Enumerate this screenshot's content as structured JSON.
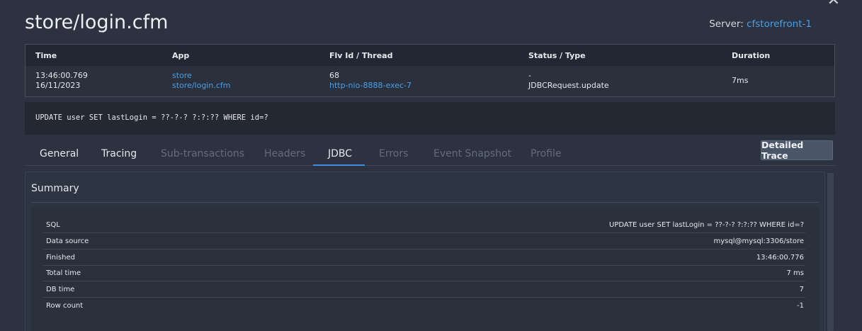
{
  "page": {
    "title": "store/login.cfm"
  },
  "server": {
    "label": "Server:",
    "name": "cfstorefront-1"
  },
  "summary": {
    "headers": {
      "time": "Time",
      "app": "App",
      "flv": "Flv Id / Thread",
      "status": "Status / Type",
      "duration": "Duration"
    },
    "row": {
      "time_line1": "13:46:00.769",
      "time_line2": "16/11/2023",
      "app_line1": "store",
      "app_line2": "store/login.cfm",
      "flv_line1": "68",
      "flv_line2": "http-nio-8888-exec-7",
      "status_line1": "-",
      "status_line2": "JDBCRequest.update",
      "duration": "7ms"
    }
  },
  "sql_statement": "UPDATE user SET lastLogin = ??-?-? ?:?:?? WHERE id=?",
  "tabs": [
    {
      "label": "General",
      "state": "enabled"
    },
    {
      "label": "Tracing",
      "state": "enabled"
    },
    {
      "label": "Sub-transactions",
      "state": "disabled"
    },
    {
      "label": "Headers",
      "state": "disabled"
    },
    {
      "label": "JDBC",
      "state": "active"
    },
    {
      "label": "Errors",
      "state": "disabled"
    },
    {
      "label": "Event Snapshot",
      "state": "disabled"
    },
    {
      "label": "Profile",
      "state": "disabled"
    }
  ],
  "detailed_trace_label": "Detailed Trace",
  "panel": {
    "title": "Summary",
    "rows": [
      {
        "key": "SQL",
        "value": "UPDATE user SET lastLogin = ??-?-? ?:?:?? WHERE id=?"
      },
      {
        "key": "Data source",
        "value": "mysql@mysql:3306/store"
      },
      {
        "key": "Finished",
        "value": "13:46:00.776"
      },
      {
        "key": "Total time",
        "value": "7 ms"
      },
      {
        "key": "DB time",
        "value": "7"
      },
      {
        "key": "Row count",
        "value": "-1"
      }
    ]
  },
  "icons": {
    "close": "close-icon"
  },
  "colors": {
    "link": "#4a9fe8",
    "active_tab_underline": "#3d8ee0",
    "background": "#2c3240"
  }
}
